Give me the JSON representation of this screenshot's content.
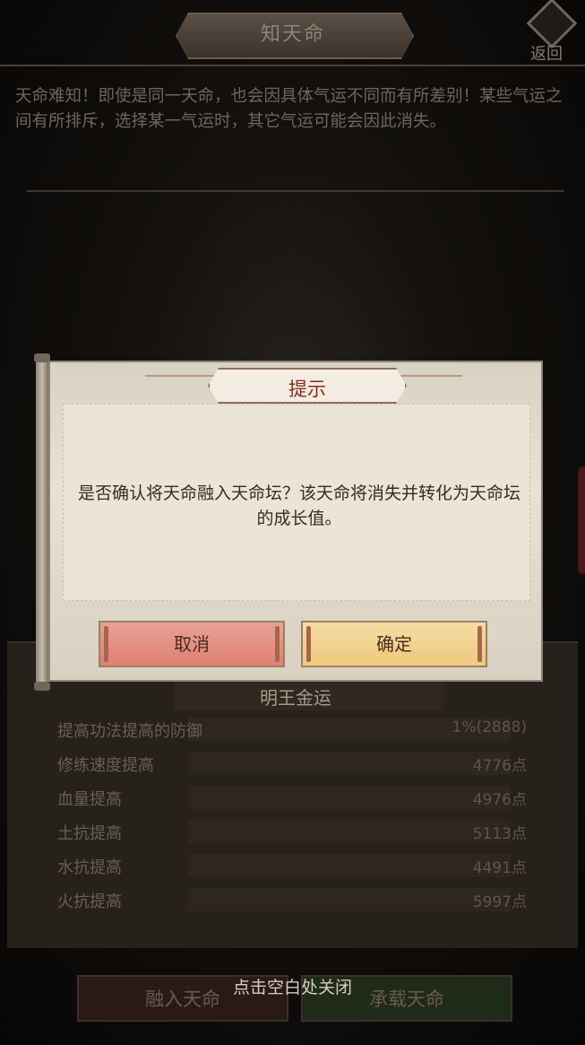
{
  "header": {
    "title": "知天命",
    "back_label": "返回",
    "description": "天命难知！即使是同一天命，也会因具体气运不同而有所差别！某些气运之间有所排斥，选择某一气运时，其它气运可能会因此消失。"
  },
  "section": {
    "title": "明王金运"
  },
  "stats": [
    {
      "name": "提高功法提高的防御",
      "value": "1%(2888)"
    },
    {
      "name": "修练速度提高",
      "value": "4776点"
    },
    {
      "name": "血量提高",
      "value": "4976点"
    },
    {
      "name": "土抗提高",
      "value": "5113点"
    },
    {
      "name": "水抗提高",
      "value": "4491点"
    },
    {
      "name": "火抗提高",
      "value": "5997点"
    }
  ],
  "bottom": {
    "merge_label": "融入天命",
    "carry_label": "承载天命",
    "close_hint": "点击空白处关闭"
  },
  "dialog": {
    "title": "提示",
    "message": "是否确认将天命融入天命坛？该天命将消失并转化为天命坛的成长值。",
    "cancel_label": "取消",
    "confirm_label": "确定"
  },
  "colors": {
    "cancel_button": "#dd8072",
    "confirm_button": "#efc97d",
    "dialog_title": "#8a2b20"
  }
}
